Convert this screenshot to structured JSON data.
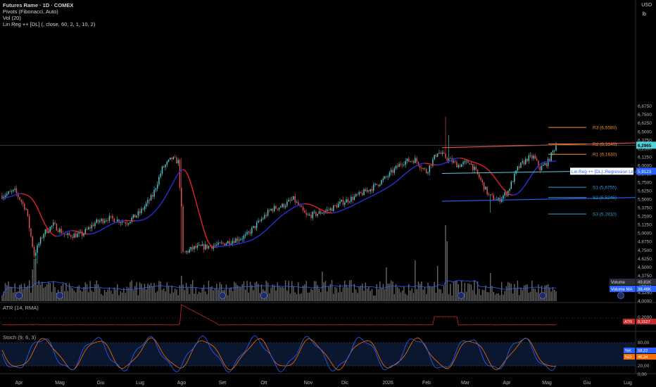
{
  "header": {
    "title": "Futures Rame · 1D · COMEX",
    "indicator_1": "Pivots (Fibonacci, Auto)",
    "indicator_2": "Vol (20)",
    "indicator_3": "Lin Reg ++ [DL] (, close, 60, 2, 1, 10, 2)"
  },
  "axis": {
    "currency": "USD",
    "unit": "lb",
    "price_ticks": [
      "6,8750",
      "6,7500",
      "6,6250",
      "6,5000",
      "6,3750",
      "6,2500",
      "6,1250",
      "6,0000",
      "5,8750",
      "5,7500",
      "5,6250",
      "5,5000",
      "5,3750",
      "5,2500",
      "5,1250",
      "5,0000",
      "4,8750",
      "4,7500",
      "4,6250",
      "4,5000",
      "4,3750",
      "4,2500",
      "4,1250",
      "4,0000"
    ],
    "price_tick_values": [
      6.875,
      6.75,
      6.625,
      6.5,
      6.375,
      6.25,
      6.125,
      6.0,
      5.875,
      5.75,
      5.625,
      5.5,
      5.375,
      5.25,
      5.125,
      5.0,
      4.875,
      4.75,
      4.625,
      4.5,
      4.375,
      4.25,
      4.125,
      4.0
    ],
    "time_labels": [
      "Apr",
      "Mag",
      "Giu",
      "Lug",
      "Ago",
      "Set",
      "Ott",
      "Nov",
      "Dic",
      "2026",
      "Feb",
      "Mar",
      "Apr",
      "Mag",
      "Giu",
      "Lug"
    ]
  },
  "pivots": [
    {
      "label": "R3 (6,5580)",
      "value": 6.558,
      "color": "#f7931e"
    },
    {
      "label": "R2 (6,3140)",
      "value": 6.314,
      "color": "#f7931e"
    },
    {
      "label": "R1 (6,1630)",
      "value": 6.163,
      "color": "#f7931e"
    },
    {
      "label": "S1 (5,6755)",
      "value": 5.6755,
      "color": "#2e9fd8"
    },
    {
      "label": "S2 (5,5245)",
      "value": 5.5245,
      "color": "#2e9fd8"
    },
    {
      "label": "S3 (5,2810)",
      "value": 5.281,
      "color": "#2e9fd8"
    }
  ],
  "badges": {
    "last_price": "6,2965",
    "regression_label": "Lin Reg ++ [DL]::Regression Line",
    "regression_value": "5,9123",
    "volume_label": "Volume",
    "volume_value": "49,81K",
    "volume_ma_label": "Volume MA",
    "volume_ma_value": "38,46K",
    "atr_tag": "ATR",
    "atr_value": "0,1527",
    "k_tag": "%K",
    "k_value": "58,22",
    "d_tag": "%D",
    "d_value": "46,34"
  },
  "atr_pane": {
    "title": "ATR (14, RMA)",
    "ticks": [
      "0,2000",
      "0,1000"
    ]
  },
  "stoch_pane": {
    "title": "Stoch (9, 6, 3)",
    "ticks": [
      "80,00",
      "20,00",
      "0,00"
    ]
  },
  "colors": {
    "up": "#4fd1d9",
    "down": "#ef5350",
    "regression": "#4fd1d9",
    "band": "#2962ff",
    "upper_line": "#ef5350",
    "ma_up": "#2a2fd9",
    "ma_down": "#e8202a",
    "volume": "#888888",
    "atr": "#c62828",
    "stoch_k": "#2962ff",
    "stoch_d": "#ff6d00",
    "axis_text": "#b2b5be"
  },
  "chart_data": {
    "type": "line",
    "title": "Futures Rame · 1D · COMEX",
    "xlabel": "",
    "ylabel": "",
    "ylim": [
      4.0,
      6.9
    ],
    "x": [
      "Apr",
      "Mag",
      "Giu",
      "Lug",
      "Ago",
      "Set",
      "Ott",
      "Nov",
      "Dic",
      "2026",
      "Feb",
      "Mar",
      "Apr",
      "Mag"
    ],
    "series": [
      {
        "name": "Futures Rame · 1D · COMEX",
        "values": [
          5.05,
          4.95,
          5.15,
          5.45,
          4.7,
          4.82,
          5.1,
          5.3,
          5.55,
          5.95,
          6.05,
          5.9,
          5.85,
          6.3
        ]
      }
    ],
    "last_price": 6.2965,
    "regression_value": 5.9123,
    "volume_last": "49,81K",
    "volume_ma": "38,46K",
    "atr_last": 0.1527,
    "stoch_k": 58.22,
    "stoch_d": 46.34,
    "grid": false,
    "legend": "top-left"
  }
}
